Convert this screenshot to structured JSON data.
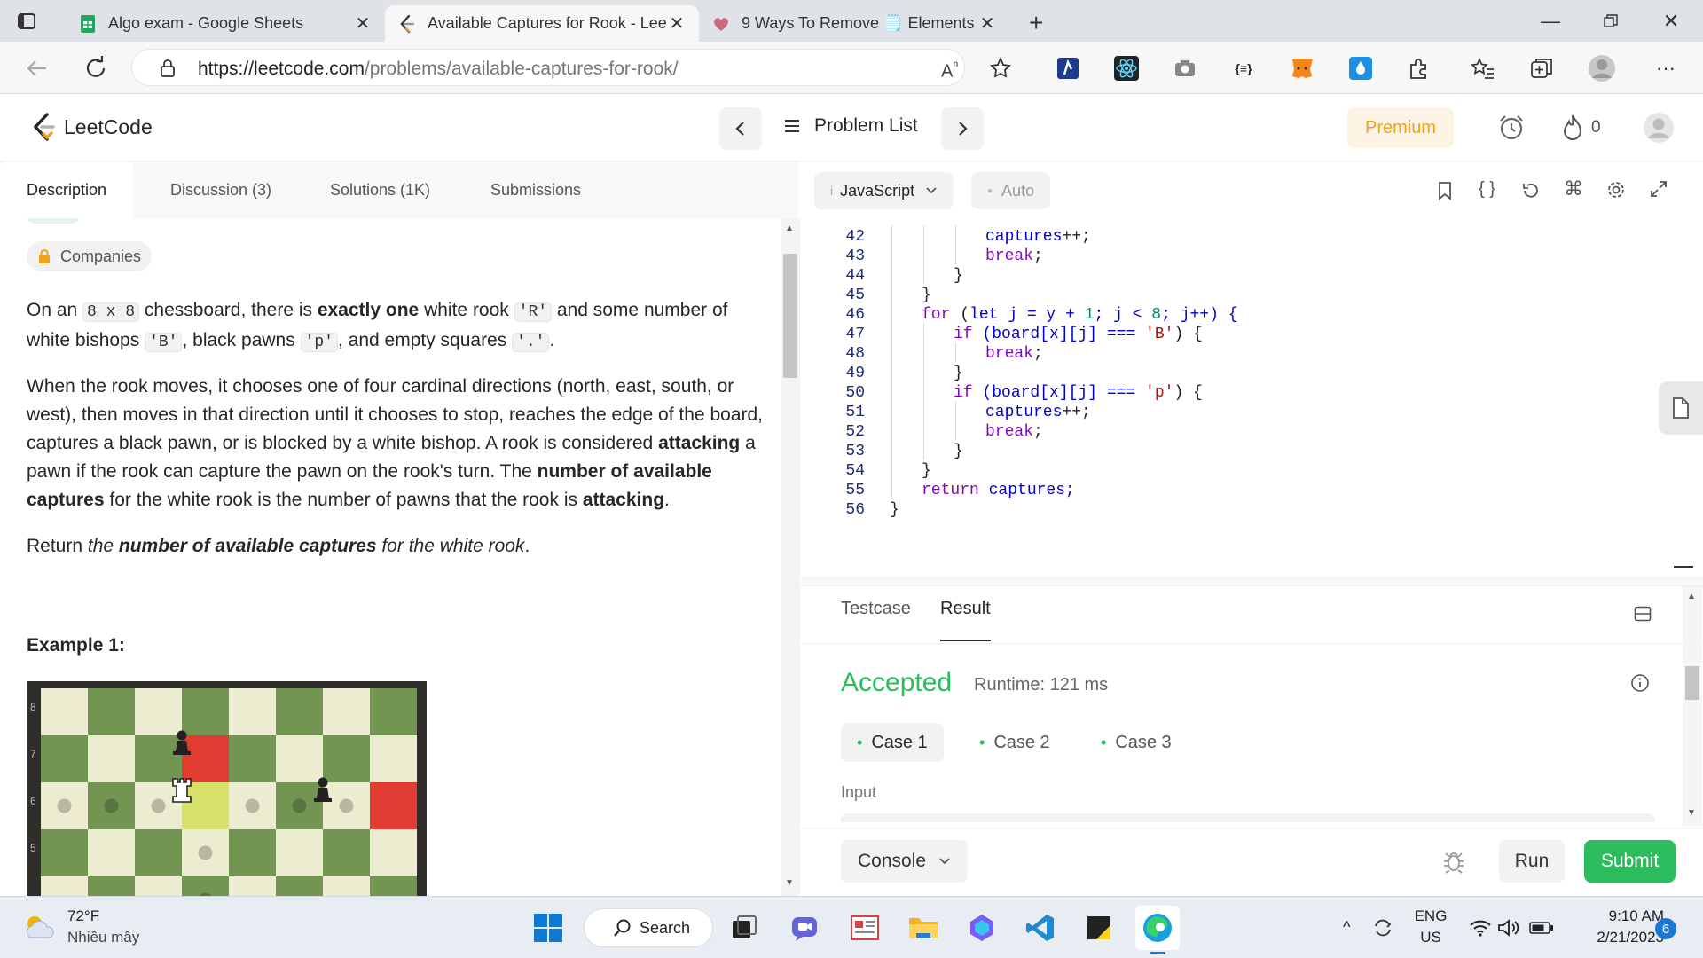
{
  "browser": {
    "tabs": [
      {
        "title": "Algo exam - Google Sheets",
        "icon": "sheets-icon",
        "active": false
      },
      {
        "title": "Available Captures for Rook - Lee",
        "icon": "leetcode-icon",
        "active": true
      },
      {
        "title": "9 Ways To Remove 🗒️ Elements",
        "icon": "heart-icon",
        "active": false
      }
    ],
    "url_domain": "https://leetcode.com",
    "url_path": "/problems/available-captures-for-rook/"
  },
  "header": {
    "logo": "LeetCode",
    "problem_list": "Problem List",
    "premium": "Premium",
    "streak": "0"
  },
  "left_tabs": [
    "Description",
    "Discussion (3)",
    "Solutions (1K)",
    "Submissions"
  ],
  "description": {
    "companies": "Companies",
    "p1_a": "On an ",
    "p1_code1": "8 x 8",
    "p1_b": " chessboard, there is ",
    "p1_bold": "exactly one",
    "p1_c": " white rook ",
    "p1_code2": "'R'",
    "p1_d": " and some number of white bishops ",
    "p1_code3": "'B'",
    "p1_e": ", black pawns ",
    "p1_code4": "'p'",
    "p1_f": ", and empty squares ",
    "p1_code5": "'.'",
    "p1_g": ".",
    "p2_a": "When the rook moves, it chooses one of four cardinal directions (north, east, south, or west), then moves in that direction until it chooses to stop, reaches the edge of the board, captures a black pawn, or is blocked by a white bishop. A rook is considered ",
    "p2_bold1": "attacking",
    "p2_b": " a pawn if the rook can capture the pawn on the rook's turn. The ",
    "p2_bold2": "number of available captures",
    "p2_c": " for the white rook is the number of pawns that the rook is ",
    "p2_bold3": "attacking",
    "p2_d": ".",
    "p3_a": "Return ",
    "p3_i1": "the ",
    "p3_bold": "number of available captures",
    "p3_i2": " for the white rook",
    "p3_b": ".",
    "example_title": "Example 1:",
    "rank_labels": [
      "8",
      "7",
      "6",
      "5"
    ]
  },
  "editor": {
    "language": "JavaScript",
    "mode": "Auto",
    "lines": [
      {
        "n": "42",
        "indent": 3,
        "parts": [
          [
            "captures",
            "kb"
          ],
          [
            "++;",
            ""
          ]
        ]
      },
      {
        "n": "43",
        "indent": 3,
        "parts": [
          [
            "break",
            "kw"
          ],
          [
            ";",
            ""
          ]
        ]
      },
      {
        "n": "44",
        "indent": 2,
        "parts": [
          [
            "}",
            ""
          ]
        ]
      },
      {
        "n": "45",
        "indent": 1,
        "parts": [
          [
            "}",
            ""
          ]
        ]
      },
      {
        "n": "46",
        "indent": 1,
        "parts": [
          [
            "for",
            "kw"
          ],
          [
            " (",
            ""
          ],
          [
            "let",
            "kb"
          ],
          [
            " j = y + ",
            "kb"
          ],
          [
            "1",
            "nm"
          ],
          [
            "; j < ",
            "kb"
          ],
          [
            "8",
            "nm"
          ],
          [
            "; j++) {",
            "kb"
          ]
        ]
      },
      {
        "n": "47",
        "indent": 2,
        "parts": [
          [
            "if",
            "kw"
          ],
          [
            " (board[x][j] === ",
            "kb"
          ],
          [
            "'B'",
            "st"
          ],
          [
            ") {",
            ""
          ]
        ]
      },
      {
        "n": "48",
        "indent": 3,
        "parts": [
          [
            "break",
            "kw"
          ],
          [
            ";",
            ""
          ]
        ]
      },
      {
        "n": "49",
        "indent": 2,
        "parts": [
          [
            "}",
            ""
          ]
        ]
      },
      {
        "n": "50",
        "indent": 2,
        "parts": [
          [
            "if",
            "kw"
          ],
          [
            " (board[x][j] === ",
            "kb"
          ],
          [
            "'p'",
            "st"
          ],
          [
            ") {",
            ""
          ]
        ]
      },
      {
        "n": "51",
        "indent": 3,
        "parts": [
          [
            "captures",
            "kb"
          ],
          [
            "++;",
            ""
          ]
        ]
      },
      {
        "n": "52",
        "indent": 3,
        "parts": [
          [
            "break",
            "kw"
          ],
          [
            ";",
            ""
          ]
        ]
      },
      {
        "n": "53",
        "indent": 2,
        "parts": [
          [
            "}",
            ""
          ]
        ]
      },
      {
        "n": "54",
        "indent": 1,
        "parts": [
          [
            "}",
            ""
          ]
        ]
      },
      {
        "n": "55",
        "indent": 1,
        "parts": [
          [
            "return",
            "kw"
          ],
          [
            " captures;",
            "kb"
          ]
        ]
      },
      {
        "n": "56",
        "indent": 0,
        "parts": [
          [
            "}",
            ""
          ]
        ]
      }
    ]
  },
  "result": {
    "tabs": [
      "Testcase",
      "Result"
    ],
    "status": "Accepted",
    "runtime": "Runtime: 121 ms",
    "cases": [
      "Case 1",
      "Case 2",
      "Case 3"
    ],
    "input_label": "Input",
    "console": "Console",
    "run": "Run",
    "submit": "Submit"
  },
  "taskbar": {
    "temp": "72°F",
    "weather": "Nhiều mây",
    "search": "Search",
    "lang1": "ENG",
    "lang2": "US",
    "time": "9:10 AM",
    "date": "2/21/2023",
    "notif": "6"
  },
  "colors": {
    "accepted": "#2cbb5d",
    "premium": "#f0a21a",
    "board_dark": "#739552",
    "board_light": "#ebecd0",
    "highlight_red": "#e03c31"
  }
}
